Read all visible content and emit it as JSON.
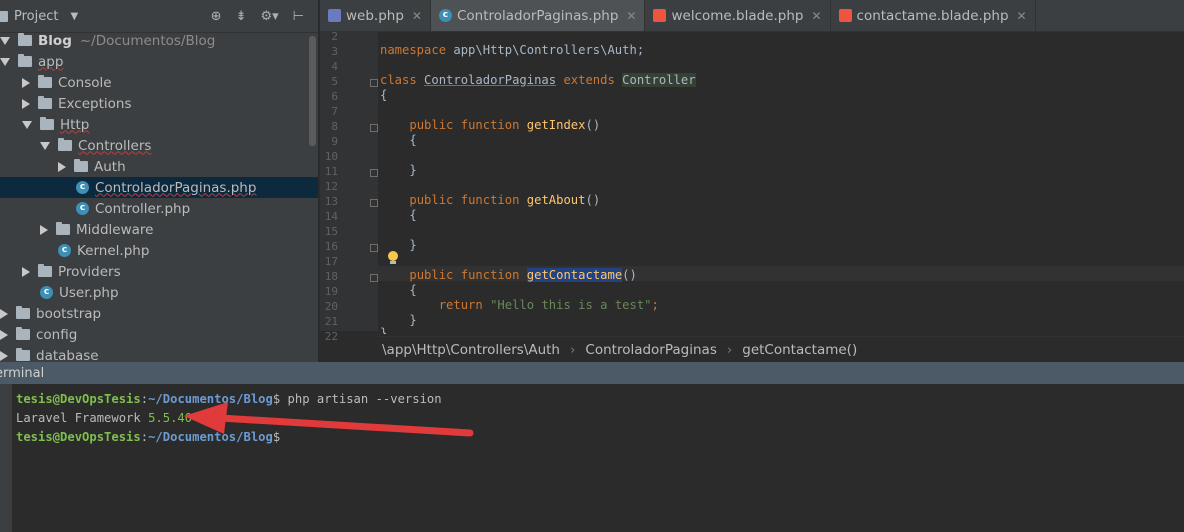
{
  "project": {
    "title": "Project",
    "tree": [
      {
        "label": "Blog",
        "extra": "~/Documentos/Blog",
        "type": "folder",
        "depth": 0,
        "expanded": true
      },
      {
        "label": "app",
        "type": "folder",
        "depth": 0,
        "expanded": true
      },
      {
        "label": "Console",
        "type": "folder",
        "depth": 1,
        "expanded": false
      },
      {
        "label": "Exceptions",
        "type": "folder",
        "depth": 1,
        "expanded": false
      },
      {
        "label": "Http",
        "type": "folder",
        "depth": 1,
        "expanded": true
      },
      {
        "label": "Controllers",
        "type": "folder",
        "depth": 2,
        "expanded": true
      },
      {
        "label": "Auth",
        "type": "folder",
        "depth": 3,
        "expanded": false
      },
      {
        "label": "ControladorPaginas.php",
        "type": "class",
        "depth": 3,
        "selected": true
      },
      {
        "label": "Controller.php",
        "type": "class",
        "depth": 3
      },
      {
        "label": "Middleware",
        "type": "folder",
        "depth": 2,
        "expanded": false
      },
      {
        "label": "Kernel.php",
        "type": "class",
        "depth": 2
      },
      {
        "label": "Providers",
        "type": "folder",
        "depth": 1,
        "expanded": false
      },
      {
        "label": "User.php",
        "type": "class",
        "depth": 1
      },
      {
        "label": "bootstrap",
        "type": "folder",
        "depth": 0,
        "expanded": false
      },
      {
        "label": "config",
        "type": "folder",
        "depth": 0,
        "expanded": false
      },
      {
        "label": "database",
        "type": "folder",
        "depth": 0,
        "expanded": false
      }
    ]
  },
  "editor": {
    "tabs": [
      {
        "label": "web.php",
        "icon": "php",
        "active": false
      },
      {
        "label": "ControladorPaginas.php",
        "icon": "class",
        "active": true
      },
      {
        "label": "welcome.blade.php",
        "icon": "blade",
        "active": false
      },
      {
        "label": "contactame.blade.php",
        "icon": "blade",
        "active": false
      }
    ],
    "line_numbers": [
      "2",
      "3",
      "4",
      "5",
      "6",
      "7",
      "8",
      "9",
      "10",
      "11",
      "12",
      "13",
      "14",
      "15",
      "16",
      "17",
      "18",
      "19",
      "20",
      "21",
      "22"
    ],
    "code": {
      "ns_kw": "namespace",
      "ns_path": " app\\Http\\Controllers\\Auth;",
      "class_kw": "class",
      "class_name": "ControladorPaginas",
      "extends_kw": "extends",
      "parent": "Controller",
      "brace_open": "{",
      "brace_close": "}",
      "public_kw": "public",
      "function_kw": "function",
      "fn1": "getIndex",
      "fn2": "getAbout",
      "fn3": "getContactame",
      "parens": "()",
      "return_kw": "return",
      "return_str": "\"Hello this is a test\"",
      "semicolon": ";"
    },
    "breadcrumb": [
      "\\app\\Http\\Controllers\\Auth",
      "ControladorPaginas",
      "getContactame()"
    ]
  },
  "terminal": {
    "title": "erminal",
    "user": "tesis@DevOpsTesis",
    "sep": ":",
    "path": "~/Documentos/Blog",
    "dollar": "$",
    "command": " php artisan --version",
    "output_label": "Laravel Framework ",
    "output_version": "5.5.40"
  },
  "colors": {
    "accent_arrow": "#e03a3a",
    "keyword": "#cc7832",
    "function": "#ffc66d",
    "string": "#6a8759"
  }
}
